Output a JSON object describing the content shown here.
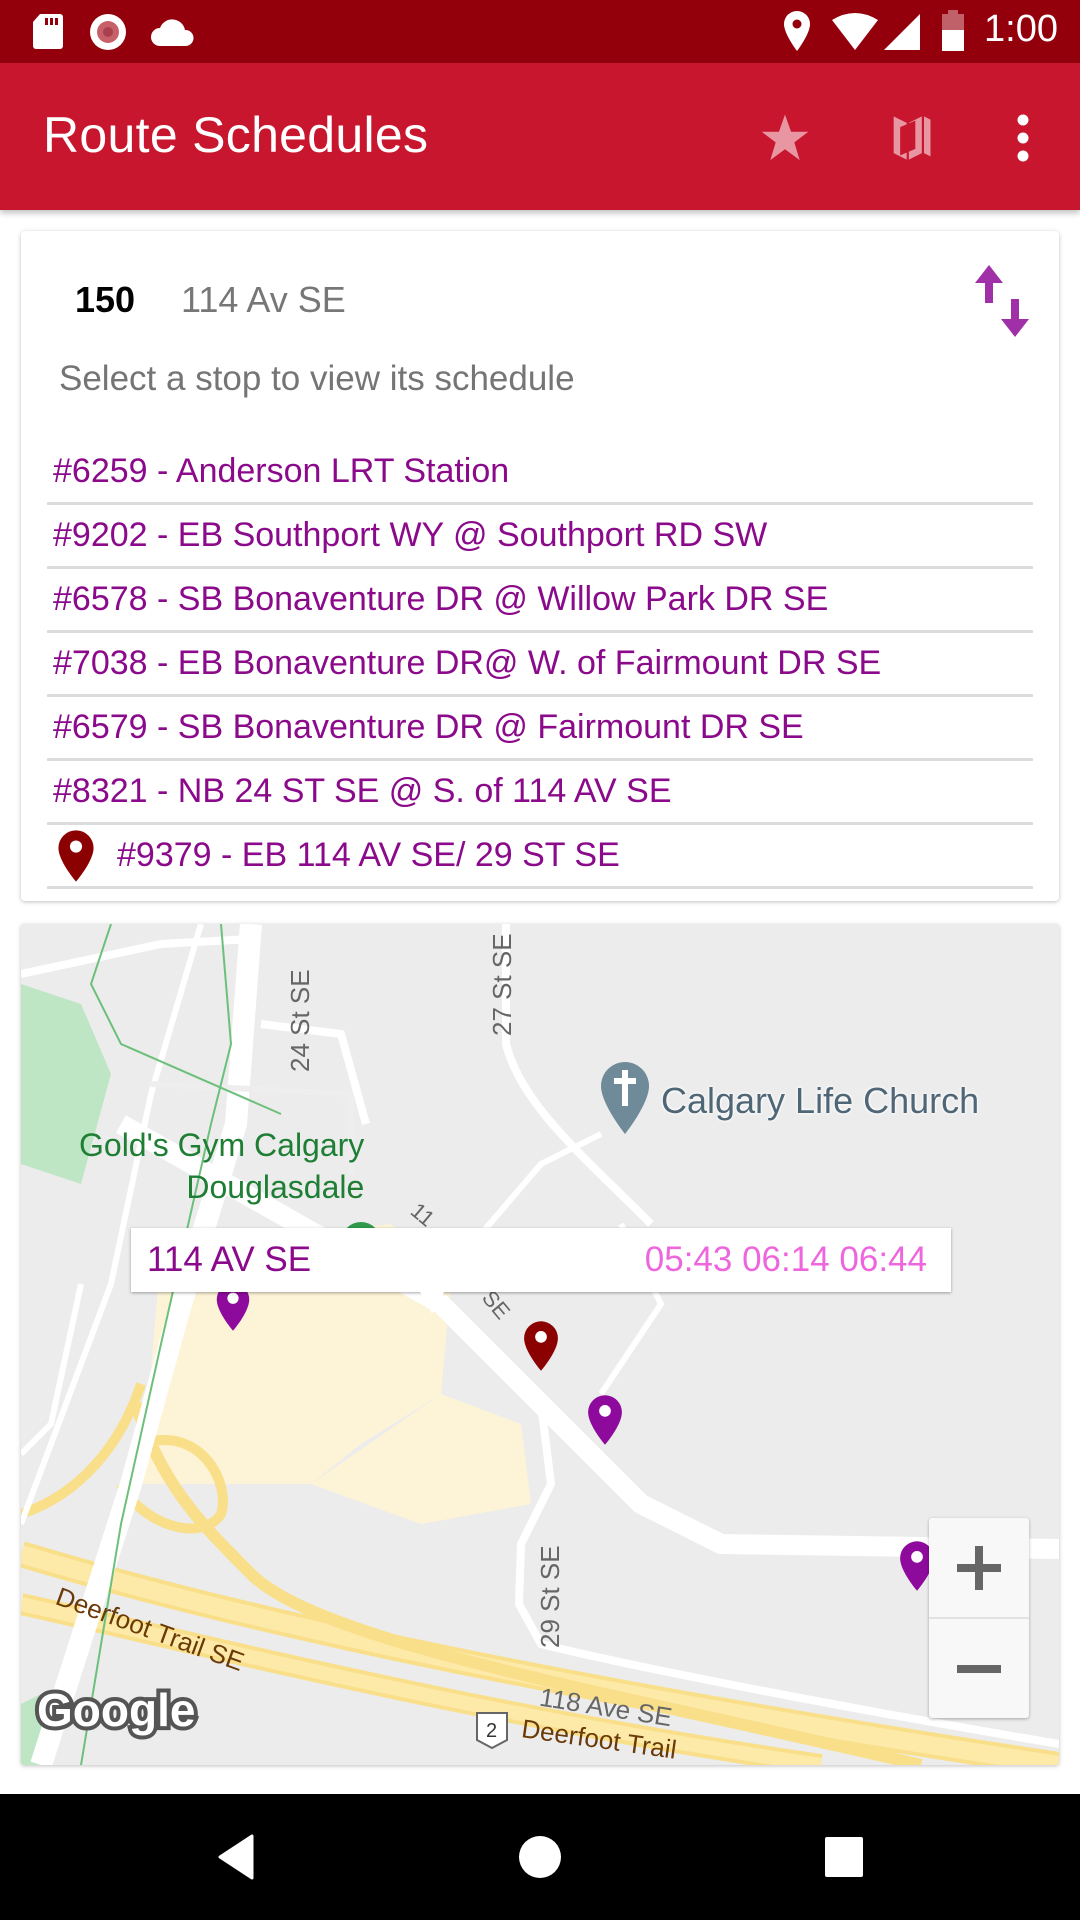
{
  "status_bar": {
    "time": "1:00",
    "left_icons": [
      "sd-card-icon",
      "record-icon",
      "cloud-icon"
    ],
    "right_icons": [
      "location-icon",
      "wifi-icon",
      "signal-icon",
      "battery-icon"
    ]
  },
  "app_bar": {
    "title": "Route Schedules",
    "actions": [
      "favorite-star",
      "map",
      "overflow-menu"
    ]
  },
  "route": {
    "number": "150",
    "name": "114 Av SE",
    "hint": "Select a stop to view its schedule"
  },
  "stops": [
    {
      "label": "#6259 - Anderson LRT Station",
      "selected": false
    },
    {
      "label": "#9202 - EB Southport WY @ Southport RD SW",
      "selected": false
    },
    {
      "label": "#6578 - SB Bonaventure DR @ Willow Park DR SE",
      "selected": false
    },
    {
      "label": "#7038 - EB Bonaventure DR@ W. of Fairmount DR SE",
      "selected": false
    },
    {
      "label": "#6579 - SB Bonaventure DR @ Fairmount DR SE",
      "selected": false
    },
    {
      "label": "#8321 - NB 24 ST SE @ S. of 114 AV SE",
      "selected": false
    },
    {
      "label": "#9379 - EB 114 AV SE/ 29 ST SE",
      "selected": true
    }
  ],
  "map": {
    "labels": {
      "street_24": "24 St SE",
      "street_27": "27 St SE",
      "street_29": "29 St SE",
      "ave_118": "118 Ave SE",
      "deerfoot_1": "Deerfoot Trail SE",
      "deerfoot_2": "Deerfoot Trail",
      "highway_shield": "2",
      "poi_gym_line1": "Gold's Gym Calgary",
      "poi_gym_line2": "Douglasdale",
      "poi_church": "Calgary Life Church",
      "partial_road_1": "11",
      "partial_road_2": "SE",
      "attribution": "Google"
    },
    "callout": {
      "stop_name": "114 AV SE",
      "times": "05:43 06:14 06:44"
    },
    "zoom_in": "+",
    "zoom_out": "−"
  },
  "colors": {
    "status_bar": "#93000c",
    "app_bar": "#c8162e",
    "stop_text": "#8b0a8b",
    "selected_marker": "#8b0000",
    "stop_marker": "#8e0a9c",
    "times_text": "#ee66dd",
    "swap_icon": "#a030a8"
  }
}
